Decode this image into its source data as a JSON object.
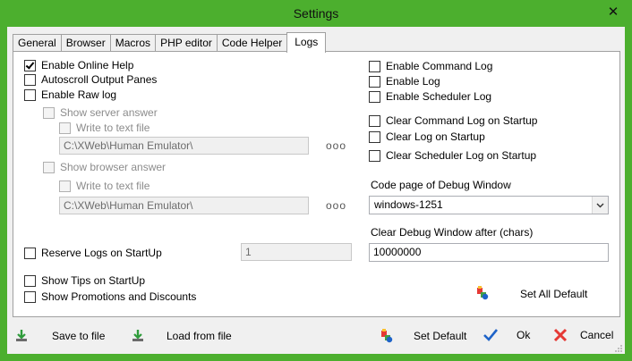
{
  "window": {
    "title": "Settings",
    "close_glyph": "✕"
  },
  "tabs": [
    {
      "label": "General"
    },
    {
      "label": "Browser"
    },
    {
      "label": "Macros"
    },
    {
      "label": "PHP editor"
    },
    {
      "label": "Code Helper"
    },
    {
      "label": "Logs"
    }
  ],
  "active_tab": "Logs",
  "left": {
    "enable_online_help": {
      "label": "Enable Online Help",
      "checked": true
    },
    "autoscroll_output": {
      "label": "Autoscroll Output Panes",
      "checked": false
    },
    "enable_raw_log": {
      "label": "Enable Raw log",
      "checked": false
    },
    "show_server_answer": {
      "label": "Show server answer",
      "checked": false
    },
    "write_text_file_1": {
      "label": "Write to text file",
      "checked": false
    },
    "path_1": "C:\\XWeb\\Human Emulator\\",
    "show_browser_answer": {
      "label": "Show browser answer",
      "checked": false
    },
    "write_text_file_2": {
      "label": "Write to text file",
      "checked": false
    },
    "path_2": "C:\\XWeb\\Human Emulator\\",
    "browse_dots": "ooo",
    "reserve_logs": {
      "label": "Reserve Logs on StartUp",
      "checked": false
    },
    "reserve_count": "1",
    "show_tips": {
      "label": "Show Tips on StartUp",
      "checked": false
    },
    "show_promotions": {
      "label": "Show Promotions and Discounts",
      "checked": false
    }
  },
  "right": {
    "enable_command_log": {
      "label": "Enable Command Log",
      "checked": false
    },
    "enable_log": {
      "label": "Enable Log",
      "checked": false
    },
    "enable_scheduler_log": {
      "label": "Enable Scheduler Log",
      "checked": false
    },
    "clear_command_log": {
      "label": "Clear Command Log on Startup",
      "checked": false
    },
    "clear_log": {
      "label": "Clear Log on Startup",
      "checked": false
    },
    "clear_scheduler_log": {
      "label": "Clear Scheduler Log on Startup",
      "checked": false
    },
    "code_page_label": "Code page of Debug Window",
    "code_page_value": "windows-1251",
    "clear_debug_label": "Clear Debug Window after (chars)",
    "clear_debug_value": "10000000",
    "set_all_default": "Set All Default"
  },
  "bottom": {
    "save_to_file": "Save to file",
    "load_from_file": "Load from file",
    "set_default": "Set Default",
    "ok": "Ok",
    "cancel": "Cancel"
  }
}
